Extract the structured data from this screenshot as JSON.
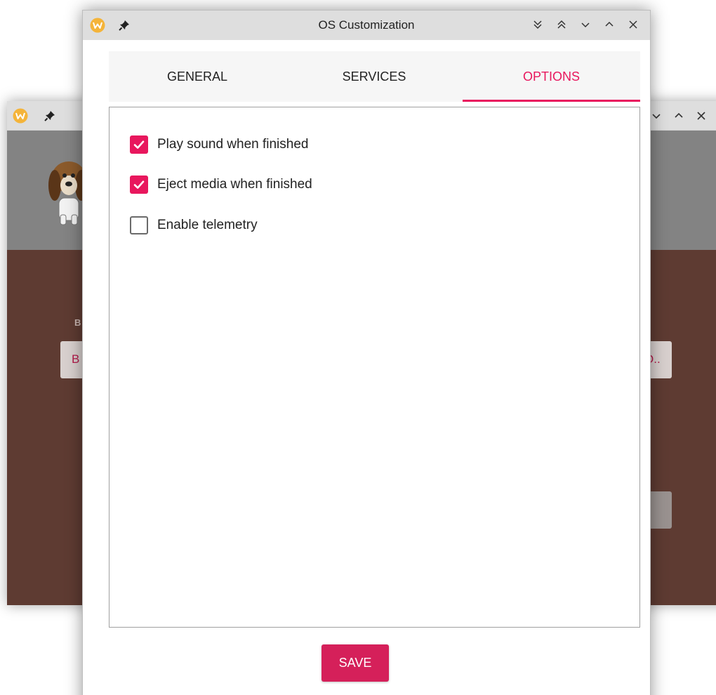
{
  "background_window": {
    "label_fragment": "B",
    "left_button_fragment": "B",
    "right_button_fragment": "O.."
  },
  "dialog": {
    "title": "OS Customization",
    "tabs": [
      {
        "label": "GENERAL",
        "active": false
      },
      {
        "label": "SERVICES",
        "active": false
      },
      {
        "label": "OPTIONS",
        "active": true
      }
    ],
    "options": [
      {
        "label": "Play sound when finished",
        "checked": true
      },
      {
        "label": "Eject media when finished",
        "checked": true
      },
      {
        "label": "Enable telemetry",
        "checked": false
      }
    ],
    "save_label": "SAVE"
  },
  "window_controls": [
    "keep-below-icon",
    "keep-above-icon",
    "minimize-icon",
    "maximize-icon",
    "close-icon"
  ],
  "icons": {
    "app": "wayfire-app-icon",
    "pin": "pin-icon",
    "mascot": "dog-mascot-icon",
    "check": "check-icon"
  },
  "colors": {
    "accent": "#e8175d",
    "save_button": "#d5205a",
    "titlebar": "#dedede",
    "bg_header": "#838383",
    "bg_body": "#5e3b32"
  }
}
